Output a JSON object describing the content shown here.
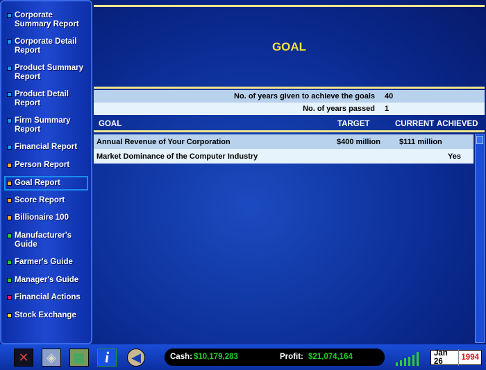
{
  "sidebar": {
    "items": [
      {
        "label": "Corporate Summary Report",
        "color": "#1a9cf0"
      },
      {
        "label": "Corporate Detail Report",
        "color": "#1a9cf0"
      },
      {
        "label": "Product Summary Report",
        "color": "#1a9cf0"
      },
      {
        "label": "Product Detail Report",
        "color": "#1a9cf0"
      },
      {
        "label": "Firm Summary Report",
        "color": "#1a9cf0"
      },
      {
        "label": "Financial Report",
        "color": "#1a9cf0"
      },
      {
        "label": "Person Report",
        "color": "#f5a830"
      },
      {
        "label": "Goal Report",
        "color": "#f5a830",
        "selected": true
      },
      {
        "label": "Score Report",
        "color": "#f5a830"
      },
      {
        "label": "Billionaire 100",
        "color": "#f5a830"
      },
      {
        "label": "Manufacturer's Guide",
        "color": "#30c830"
      },
      {
        "label": "Farmer's Guide",
        "color": "#30c830"
      },
      {
        "label": "Manager's Guide",
        "color": "#30c830"
      },
      {
        "label": "Financial Actions",
        "color": "#f01860"
      },
      {
        "label": "Stock Exchange",
        "color": "#e8d030"
      }
    ]
  },
  "main": {
    "title": "GOAL",
    "info": [
      {
        "label": "No. of years given to achieve the goals",
        "value": "40"
      },
      {
        "label": "No. of years passed",
        "value": "1"
      }
    ],
    "columns": {
      "goal": "GOAL",
      "target": "TARGET",
      "current": "CURRENT",
      "achieved": "ACHIEVED"
    },
    "rows": [
      {
        "goal": "Annual Revenue of Your Corporation",
        "target": "$400 million",
        "current": "$111 million",
        "achieved": ""
      },
      {
        "goal": "Market Dominance of the Computer Industry",
        "target": "",
        "current": "",
        "achieved": "Yes"
      }
    ]
  },
  "bottom": {
    "tools": [
      "tools-icon",
      "map-icon",
      "world-map-icon",
      "info-icon",
      "back-icon"
    ],
    "cash_label": "Cash:",
    "cash": "$10,179,283",
    "profit_label": "Profit:",
    "profit": "$21,074,164",
    "date": "Jan 26",
    "year": "1994"
  }
}
